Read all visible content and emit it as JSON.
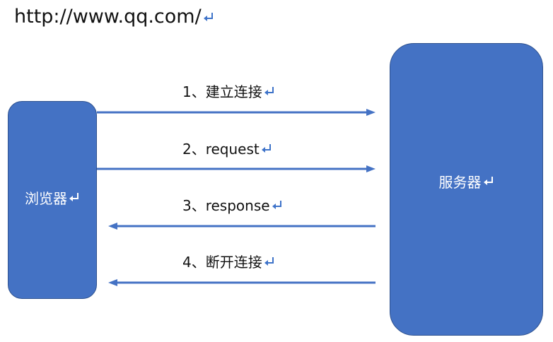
{
  "url": "http://www.qq.com/",
  "browser_label": "浏览器",
  "server_label": "服务器",
  "steps": [
    {
      "label": "1、建立连接",
      "direction": "browser-to-server"
    },
    {
      "label": "2、request",
      "direction": "browser-to-server"
    },
    {
      "label": "3、response",
      "direction": "server-to-browser"
    },
    {
      "label": "4、断开连接",
      "direction": "server-to-browser"
    }
  ],
  "colors": {
    "box_fill": "#4472c4",
    "box_border": "#2f528f",
    "arrow": "#4472c4",
    "return_mark": "#3e73c9"
  },
  "icons": {
    "return_mark": "paragraph-return-icon"
  }
}
